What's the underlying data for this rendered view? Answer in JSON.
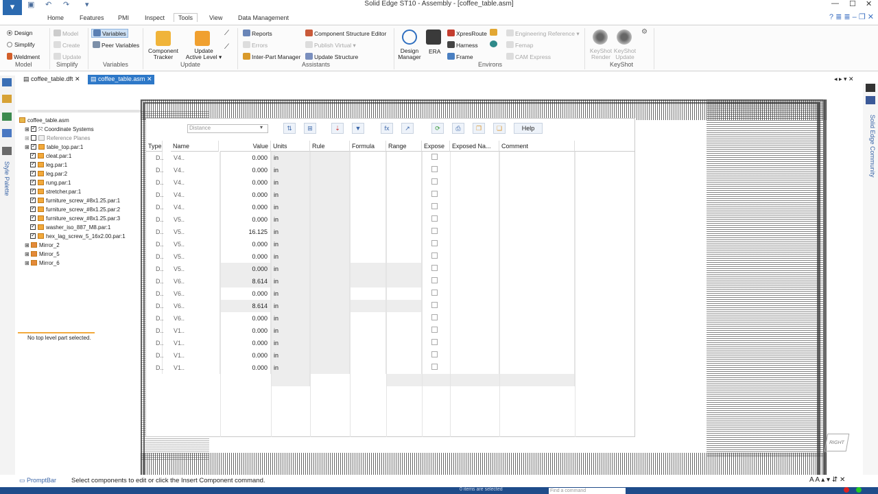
{
  "titlebar": {
    "title": "Solid Edge ST10 - Assembly - [coffee_table.asm]"
  },
  "ribbon": {
    "tabs": [
      "Home",
      "Features",
      "PMI",
      "Inspect",
      "Tools",
      "View",
      "Data Management"
    ],
    "active_tab": "Tools",
    "model_group": {
      "design": "Design",
      "simplify": "Simplify",
      "weldment": "Weldment",
      "label": "Model"
    },
    "simplify_group": {
      "model": "Model",
      "create": "Create",
      "update": "Update",
      "label": "Simplify"
    },
    "variables_group": {
      "variables": "Variables",
      "peer_variables": "Peer Variables",
      "label": "Variables"
    },
    "update_group": {
      "component_tracker": [
        "Component",
        "Tracker"
      ],
      "update_active_level": [
        "Update",
        "Active Level"
      ],
      "label": "Update"
    },
    "assistants_group": {
      "reports": "Reports",
      "errors": "Errors",
      "inter_part_manager": "Inter-Part Manager",
      "component_structure_editor": "Component Structure Editor",
      "publish_virtual": "Publish Virtual",
      "update_structure": "Update Structure",
      "label": "Assistants"
    },
    "environs_group": {
      "design_manager": [
        "Design",
        "Manager"
      ],
      "era": "ERA",
      "xpresroute": "XpresRoute",
      "harness": "Harness",
      "frame": "Frame",
      "engineering_reference": "Engineering Reference",
      "femap": "Femap",
      "cam_express": "CAM Express",
      "label": "Environs"
    },
    "keyshot_group": {
      "render": [
        "KeyShot",
        "Render"
      ],
      "update": [
        "KeyShot",
        "Update"
      ],
      "label": "KeyShot"
    }
  },
  "doc_tabs": [
    "coffee_table.dft",
    "coffee_table.asm"
  ],
  "active_doc_tab": "coffee_table.asm",
  "left_panel": {
    "style_palette": "Style Palette"
  },
  "right_panel": {
    "community": "Solid Edge Community"
  },
  "tree": {
    "root": "coffee_table.asm",
    "items": [
      "Coordinate Systems",
      "Reference Planes",
      "table_top.par:1",
      "cleat.par:1",
      "leg.par:1",
      "leg.par:2",
      "rung.par:1",
      "stretcher.par:1",
      "furniture_screw_#8x1.25.par:1",
      "furniture_screw_#8x1.25.par:2",
      "furniture_screw_#8x1.25.par:3",
      "washer_iso_887_M8.par:1",
      "hex_lag_screw_5_16x2.00.par:1",
      "Mirror_2",
      "Mirror_5",
      "Mirror_6"
    ],
    "status": "No top level part selected."
  },
  "variable_table": {
    "filter_value": "Distance",
    "help_label": "Help",
    "columns": [
      "Type",
      "Name",
      "Value",
      "Units",
      "Rule",
      "Formula",
      "Range",
      "Expose",
      "Exposed Na...",
      "Comment"
    ],
    "rows": [
      {
        "type": "D..",
        "name": "V4..",
        "value": "0.000",
        "units": "in"
      },
      {
        "type": "D..",
        "name": "V4..",
        "value": "0.000",
        "units": "in"
      },
      {
        "type": "D..",
        "name": "V4..",
        "value": "0.000",
        "units": "in"
      },
      {
        "type": "D..",
        "name": "V4..",
        "value": "0.000",
        "units": "in"
      },
      {
        "type": "D..",
        "name": "V4..",
        "value": "0.000",
        "units": "in"
      },
      {
        "type": "D..",
        "name": "V5..",
        "value": "0.000",
        "units": "in"
      },
      {
        "type": "D..",
        "name": "V5..",
        "value": "16.125",
        "units": "in"
      },
      {
        "type": "D..",
        "name": "V5..",
        "value": "0.000",
        "units": "in"
      },
      {
        "type": "D..",
        "name": "V5..",
        "value": "0.000",
        "units": "in"
      },
      {
        "type": "D..",
        "name": "V5..",
        "value": "0.000",
        "units": "in"
      },
      {
        "type": "D..",
        "name": "V6..",
        "value": "8.614",
        "units": "in"
      },
      {
        "type": "D..",
        "name": "V6..",
        "value": "0.000",
        "units": "in"
      },
      {
        "type": "D..",
        "name": "V6..",
        "value": "8.614",
        "units": "in"
      },
      {
        "type": "D..",
        "name": "V6..",
        "value": "0.000",
        "units": "in"
      },
      {
        "type": "D..",
        "name": "V1..",
        "value": "0.000",
        "units": "in"
      },
      {
        "type": "D..",
        "name": "V1..",
        "value": "0.000",
        "units": "in"
      },
      {
        "type": "D..",
        "name": "V1..",
        "value": "0.000",
        "units": "in"
      },
      {
        "type": "D..",
        "name": "V1..",
        "value": "0.000",
        "units": "in"
      }
    ]
  },
  "statusbar": {
    "promptbar_label": "PromptBar",
    "prompt": "Select components to edit or click the Insert Component command.",
    "items_selected": "0 items are selected",
    "find_placeholder": "Find a command"
  },
  "view_cube": {
    "label": "RIGHT"
  },
  "colors": {
    "accent": "#2d78c8",
    "status_strip": "#1f4c8a"
  }
}
